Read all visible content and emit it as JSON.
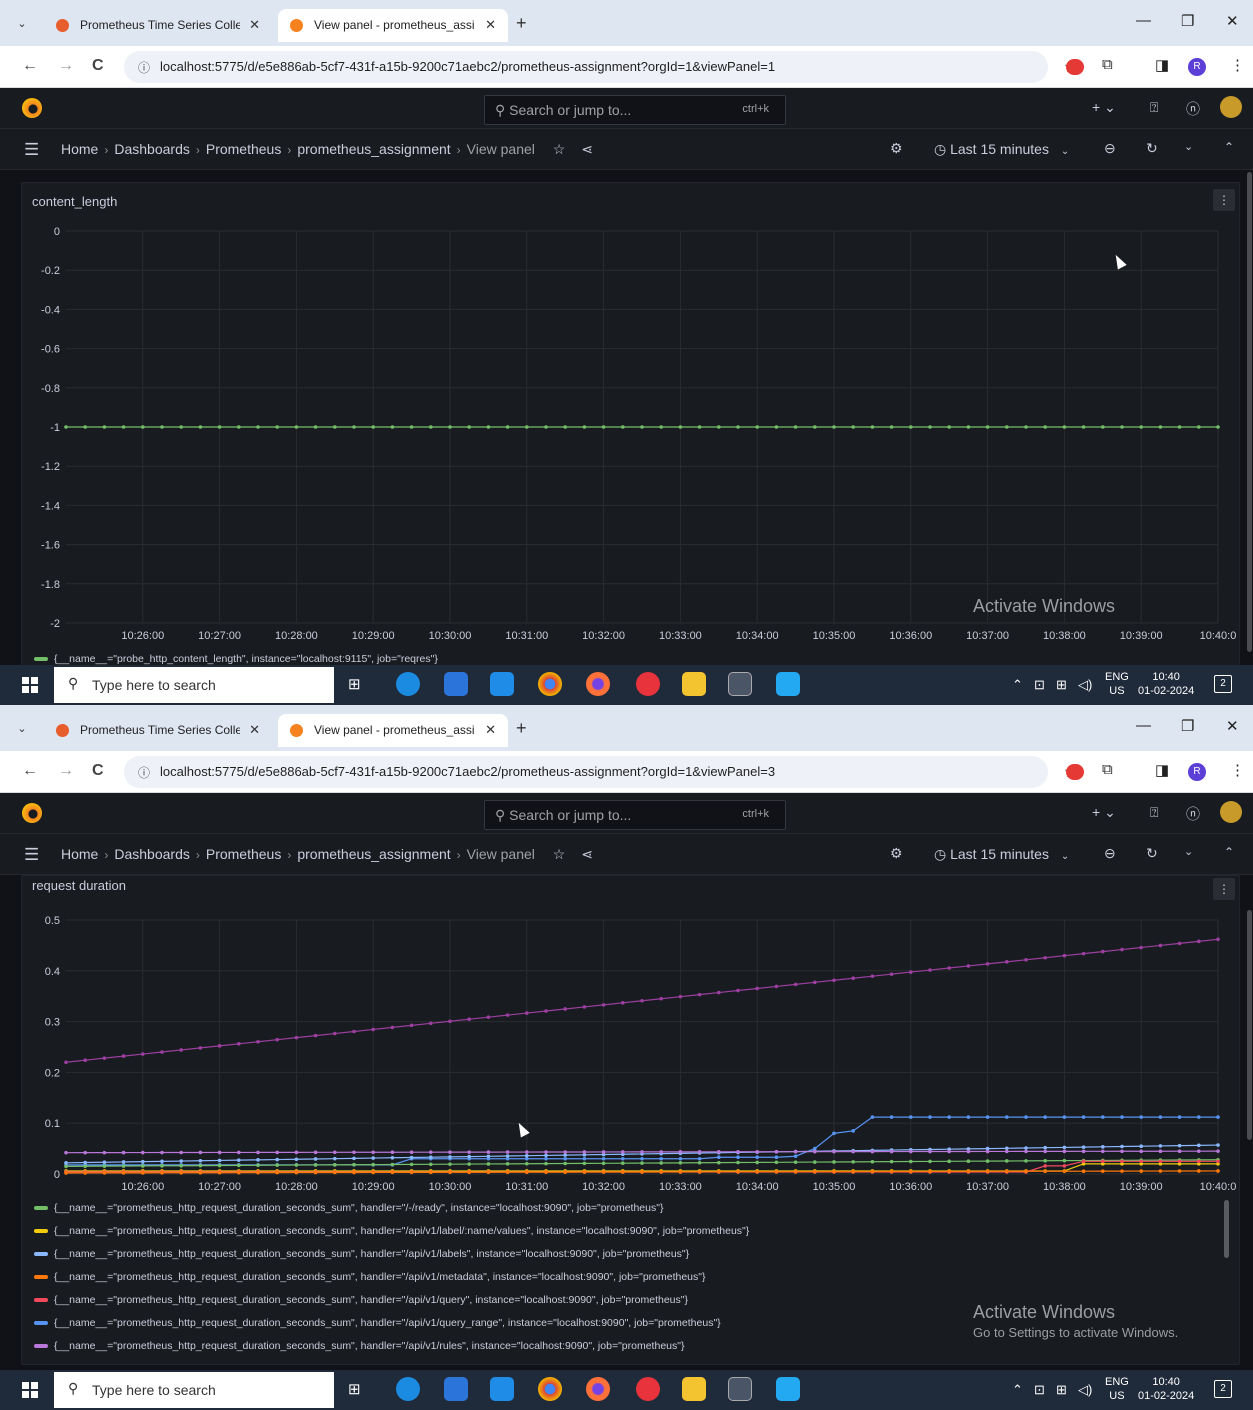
{
  "browser": {
    "tab_inactive": "Prometheus Time Series Collect",
    "tab_active": "View panel - prometheus_assig",
    "tab_close": "✕",
    "new_tab": "+",
    "win_min": "—",
    "win_restore": "❐",
    "win_close": "✕",
    "back": "←",
    "forward": "→",
    "reload": "C",
    "url_1": "localhost:5775/d/e5e886ab-5cf7-431f-a15b-9200c71aebc2/prometheus-assignment?orgId=1&viewPanel=1",
    "url_2": "localhost:5775/d/e5e886ab-5cf7-431f-a15b-9200c71aebc2/prometheus-assignment?orgId=1&viewPanel=3",
    "profile_initial": "R"
  },
  "grafana": {
    "search_placeholder": "Search or jump to...",
    "search_shortcut": "ctrl+k",
    "breadcrumbs": [
      "Home",
      "Dashboards",
      "Prometheus",
      "prometheus_assignment",
      "View panel"
    ],
    "time_range": "Last 15 minutes"
  },
  "watermark": {
    "title": "Activate Windows",
    "subtitle": "Go to Settings to activate Windows."
  },
  "taskbar": {
    "search_placeholder": "Type here to search",
    "lang_top": "ENG",
    "lang_bottom": "US",
    "time": "10:40",
    "date": "01-02-2024",
    "notif_count": "2"
  },
  "panel1": {
    "title": "content_length",
    "legend": [
      {
        "label": "{__name__=\"probe_http_content_length\", instance=\"localhost:9115\", job=\"reqres\"}",
        "color": "#73bf69"
      }
    ],
    "chart_data": {
      "type": "line",
      "ylim": [
        -2,
        0
      ],
      "yticks": [
        0,
        -0.2,
        -0.4,
        -0.6,
        -0.8,
        -1,
        -1.2,
        -1.4,
        -1.6,
        -1.8,
        -2
      ],
      "x_range": [
        "10:25:00",
        "10:40:00"
      ],
      "xticks": [
        "10:26:00",
        "10:27:00",
        "10:28:00",
        "10:29:00",
        "10:30:00",
        "10:31:00",
        "10:32:00",
        "10:33:00",
        "10:34:00",
        "10:35:00",
        "10:36:00",
        "10:37:00",
        "10:38:00",
        "10:39:00",
        "10:40:0"
      ],
      "series": [
        {
          "color": "#73bf69",
          "start": -1,
          "end": -1,
          "steps": []
        }
      ]
    }
  },
  "panel2": {
    "title": "request duration",
    "legend": [
      {
        "label": "{__name__=\"prometheus_http_request_duration_seconds_sum\", handler=\"/-/ready\", instance=\"localhost:9090\", job=\"prometheus\"}",
        "color": "#73bf69"
      },
      {
        "label": "{__name__=\"prometheus_http_request_duration_seconds_sum\", handler=\"/api/v1/label/:name/values\", instance=\"localhost:9090\", job=\"prometheus\"}",
        "color": "#f2cc0c"
      },
      {
        "label": "{__name__=\"prometheus_http_request_duration_seconds_sum\", handler=\"/api/v1/labels\", instance=\"localhost:9090\", job=\"prometheus\"}",
        "color": "#8ab8ff"
      },
      {
        "label": "{__name__=\"prometheus_http_request_duration_seconds_sum\", handler=\"/api/v1/metadata\", instance=\"localhost:9090\", job=\"prometheus\"}",
        "color": "#ff780a"
      },
      {
        "label": "{__name__=\"prometheus_http_request_duration_seconds_sum\", handler=\"/api/v1/query\", instance=\"localhost:9090\", job=\"prometheus\"}",
        "color": "#f2495c"
      },
      {
        "label": "{__name__=\"prometheus_http_request_duration_seconds_sum\", handler=\"/api/v1/query_range\", instance=\"localhost:9090\", job=\"prometheus\"}",
        "color": "#5794f2"
      },
      {
        "label": "{__name__=\"prometheus_http_request_duration_seconds_sum\", handler=\"/api/v1/rules\", instance=\"localhost:9090\", job=\"prometheus\"}",
        "color": "#b877d9"
      }
    ],
    "chart_data": {
      "type": "line",
      "ylim": [
        0,
        0.5
      ],
      "yticks": [
        0.5,
        0.4,
        0.3,
        0.2,
        0.1,
        0
      ],
      "x_range": [
        "10:25:00",
        "10:40:00"
      ],
      "xticks": [
        "10:26:00",
        "10:27:00",
        "10:28:00",
        "10:29:00",
        "10:30:00",
        "10:31:00",
        "10:32:00",
        "10:33:00",
        "10:34:00",
        "10:35:00",
        "10:36:00",
        "10:37:00",
        "10:38:00",
        "10:39:00",
        "10:40:0"
      ],
      "series": [
        {
          "color": "#9c3fa0",
          "start": 0.22,
          "end": 0.462,
          "steps": []
        },
        {
          "color": "#5794f2",
          "start": 0.018,
          "end": 0.018,
          "steps": [
            [
              0.3,
              0.03
            ],
            [
              0.56,
              0.033
            ],
            [
              0.62,
              0.035
            ],
            [
              0.645,
              0.05
            ],
            [
              0.66,
              0.08
            ],
            [
              0.68,
              0.085
            ],
            [
              0.695,
              0.112
            ]
          ]
        },
        {
          "color": "#8ab8ff",
          "start": 0.022,
          "end": 0.057,
          "steps": []
        },
        {
          "color": "#b877d9",
          "start": 0.042,
          "end": 0.045,
          "steps": []
        },
        {
          "color": "#73bf69",
          "start": 0.015,
          "end": 0.028,
          "steps": []
        },
        {
          "color": "#f2cc0c",
          "start": 0.006,
          "end": 0.018,
          "steps": [
            [
              0.88,
              0.02
            ]
          ]
        },
        {
          "color": "#f2495c",
          "start": 0.004,
          "end": 0.012,
          "steps": [
            [
              0.84,
              0.016
            ],
            [
              0.87,
              0.025
            ]
          ]
        },
        {
          "color": "#ff780a",
          "start": 0.002,
          "end": 0.006,
          "steps": []
        }
      ]
    }
  }
}
